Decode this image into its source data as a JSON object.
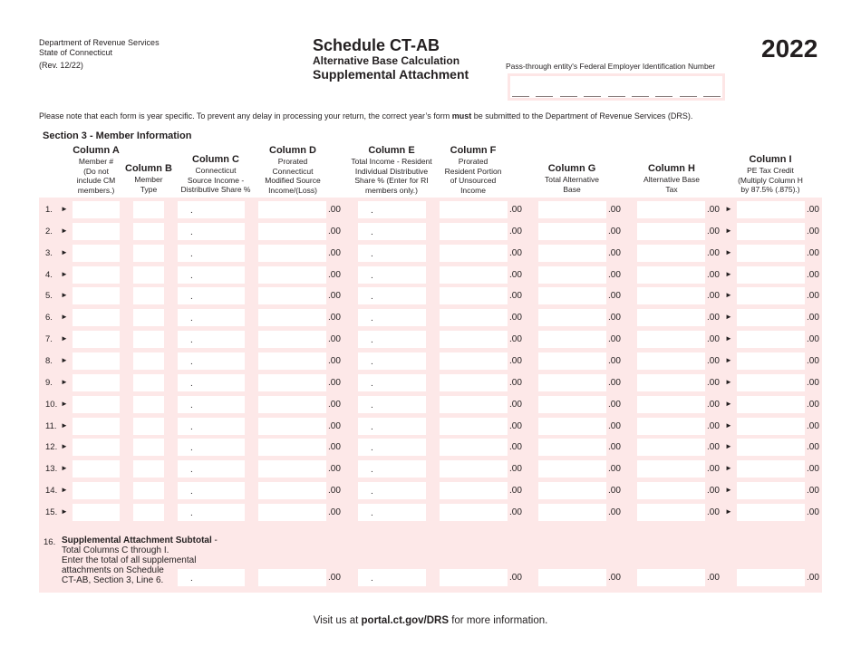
{
  "header": {
    "agency_line1": "Department of Revenue Services",
    "agency_line2": "State of Connecticut",
    "revision": "(Rev. 12/22)",
    "title": "Schedule CT-AB",
    "subtitle1": "Alternative Base Calculation",
    "subtitle2": "Supplemental Attachment",
    "year": "2022",
    "fein_label": "Pass-through entity's Federal Employer Identification Number",
    "fein_value": ""
  },
  "notice": {
    "before_bold": "Please note that each form is year specific. To prevent any delay in processing your return, the correct year’s form ",
    "bold": "must",
    "after_bold": " be submitted to the Department of Revenue Services (DRS)."
  },
  "section_title": "Section 3 - Member Information",
  "columns": [
    {
      "key": "A",
      "title": "Column A",
      "desc": "Member # (Do not include CM members.)"
    },
    {
      "key": "B",
      "title": "Column B",
      "desc": "Member Type"
    },
    {
      "key": "C",
      "title": "Column C",
      "desc": "Connecticut Source Income - Distributive Share %"
    },
    {
      "key": "D",
      "title": "Column D",
      "desc": "Prorated Connecticut Modified Source Income/(Loss)"
    },
    {
      "key": "E",
      "title": "Column E",
      "desc": "Total Income - Resident Individual Distributive Share % (Enter for RI members only.)"
    },
    {
      "key": "F",
      "title": "Column F",
      "desc": "Prorated Resident Portion of Unsourced Income"
    },
    {
      "key": "G",
      "title": "Column G",
      "desc": "Total Alternative Base"
    },
    {
      "key": "H",
      "title": "Column H",
      "desc": "Alternative Base Tax"
    },
    {
      "key": "I",
      "title": "Column I",
      "desc": "PE Tax Credit (Multiply Column H by 87.5% (.875).)"
    }
  ],
  "column_desc_lines": {
    "A": [
      "Member #",
      "(Do not",
      "include CM",
      "members.)"
    ],
    "B": [
      "Member",
      "Type"
    ],
    "C": [
      "Connecticut",
      "Source Income -",
      "Distributive Share %"
    ],
    "D": [
      "Prorated",
      "Connecticut",
      "Modified Source",
      "Income/(Loss)"
    ],
    "E": [
      "Total Income - Resident",
      "Individual Distributive",
      "Share % (Enter for RI",
      "members only.)"
    ],
    "F": [
      "Prorated",
      "Resident Portion",
      "of Unsourced",
      "Income"
    ],
    "G": [
      "Total Alternative",
      "Base"
    ],
    "H": [
      "Alternative Base",
      "Tax"
    ],
    "I": [
      "PE Tax Credit",
      "(Multiply Column H",
      "by 87.5% (.875).)"
    ]
  },
  "rows": [
    {
      "num": "1."
    },
    {
      "num": "2."
    },
    {
      "num": "3."
    },
    {
      "num": "4."
    },
    {
      "num": "5."
    },
    {
      "num": "6."
    },
    {
      "num": "7."
    },
    {
      "num": "8."
    },
    {
      "num": "9."
    },
    {
      "num": "10."
    },
    {
      "num": "11."
    },
    {
      "num": "12."
    },
    {
      "num": "13."
    },
    {
      "num": "14."
    },
    {
      "num": "15."
    }
  ],
  "decimal_point": ".",
  "cents_suffix": ".00",
  "arrow_glyph": "►",
  "line16": {
    "num": "16.",
    "title": "Supplemental Attachment Subtotal",
    "title_suffix": " -",
    "lines": [
      "Total Columns C through I.",
      "Enter the total of all supplemental",
      "attachments on Schedule",
      "CT-AB, Section 3, Line 6."
    ]
  },
  "footer": {
    "before": "Visit us at ",
    "link": "portal.ct.gov/DRS",
    "after": " for more information."
  },
  "colors": {
    "field_background": "#fde8e8",
    "text": "#231f20"
  }
}
